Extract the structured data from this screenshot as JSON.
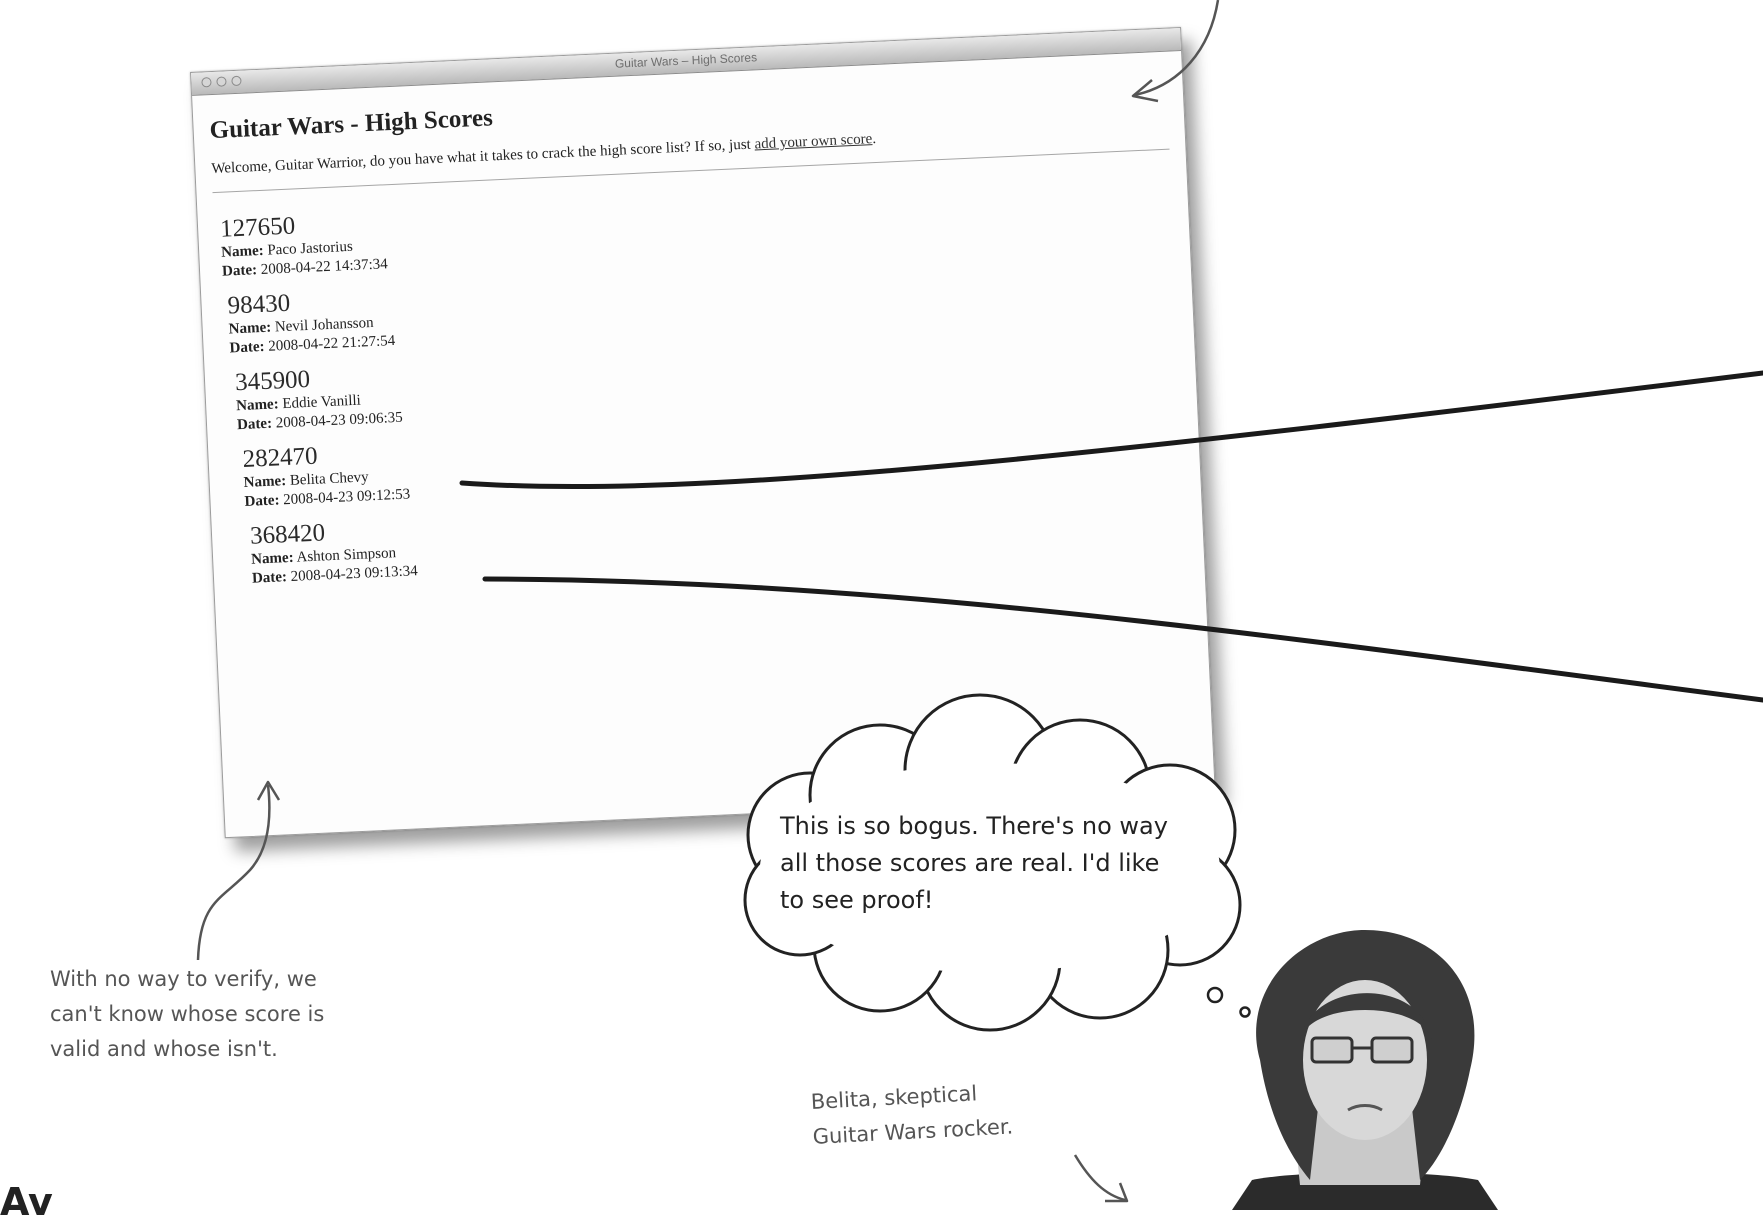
{
  "window": {
    "title": "Guitar Wars – High Scores"
  },
  "page": {
    "heading": "Guitar Wars - High Scores",
    "intro": "Welcome, Guitar Warrior, do you have what it takes to crack the high score list? If so, just ",
    "intro_link": "add your own score",
    "intro_end": ".",
    "name_label": "Name:",
    "date_label": "Date:"
  },
  "scores": [
    {
      "score": "127650",
      "name": "Paco Jastorius",
      "date": "2008-04-22 14:37:34"
    },
    {
      "score": "98430",
      "name": "Nevil Johansson",
      "date": "2008-04-22 21:27:54"
    },
    {
      "score": "345900",
      "name": "Eddie Vanilli",
      "date": "2008-04-23 09:06:35"
    },
    {
      "score": "282470",
      "name": "Belita Chevy",
      "date": "2008-04-23 09:12:53"
    },
    {
      "score": "368420",
      "name": "Ashton Simpson",
      "date": "2008-04-23 09:13:34"
    }
  ],
  "annotations": {
    "thought_bubble": "This is so bogus. There's no way all those scores are real. I'd like to see proof!",
    "note_left": [
      "With no way to verify, we",
      "can't know whose score is",
      "valid and whose isn't."
    ],
    "caption": [
      "Belita, skeptical",
      "Guitar Wars rocker."
    ]
  },
  "bottom_heading": "Av"
}
